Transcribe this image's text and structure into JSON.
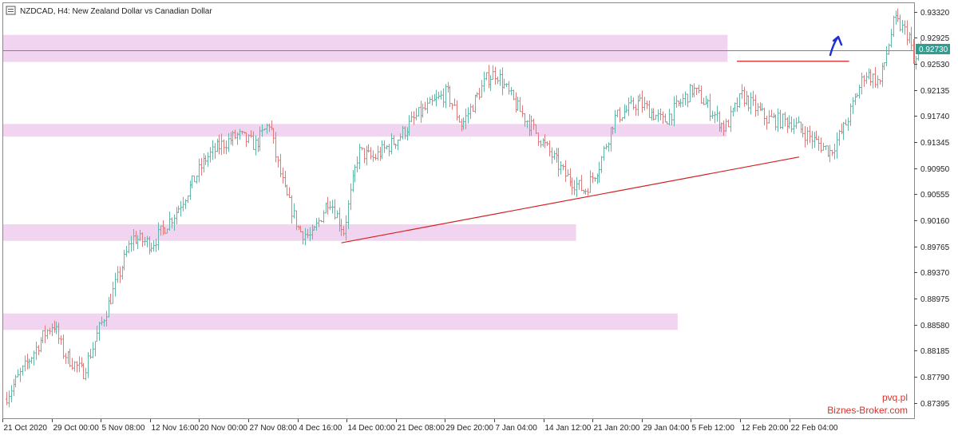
{
  "chart_data": {
    "type": "candlestick",
    "title": "NZDCAD, H4:  New Zealand Dollar vs Canadian Dollar",
    "watermark": [
      "pvq.pl",
      "Biznes-Broker.com"
    ],
    "current_price": "0.92730",
    "ylim": [
      0.8715,
      0.9345
    ],
    "y_ticks": [
      "0.93320",
      "0.92925",
      "0.92530",
      "0.92135",
      "0.91740",
      "0.91345",
      "0.90950",
      "0.90555",
      "0.90160",
      "0.89765",
      "0.89370",
      "0.88975",
      "0.88580",
      "0.88185",
      "0.87790",
      "0.87395"
    ],
    "x_ticks": [
      "21 Oct 2020",
      "29 Oct 00:00",
      "5 Nov 08:00",
      "12 Nov 16:00",
      "20 Nov 00:00",
      "27 Nov 08:00",
      "4 Dec 16:00",
      "14 Dec 00:00",
      "21 Dec 08:00",
      "29 Dec 20:00",
      "7 Jan 04:00",
      "14 Jan 12:00",
      "21 Jan 20:00",
      "29 Jan 04:00",
      "5 Feb 12:00",
      "12 Feb 20:00",
      "22 Feb 04:00"
    ],
    "colors": {
      "bull": "#5fb8a8",
      "bear": "#e07b7b",
      "zone": "#f0d4f0",
      "trend": "#d42020",
      "price_line": "#3aa39a",
      "price_label": "#2e9e92",
      "arrow": "#1f2fd8"
    },
    "zones": [
      {
        "from": 0.9256,
        "to": 0.9297,
        "end": "5 Feb 12:00"
      },
      {
        "from": 0.9143,
        "to": 0.9162,
        "end": "5 Feb 12:00"
      },
      {
        "from": 0.8985,
        "to": 0.901,
        "end": "14 Jan 12:00"
      },
      {
        "from": 0.885,
        "to": 0.8875,
        "end": "29 Jan 04:00"
      }
    ],
    "trendlines": [
      {
        "from": [
          "4 Dec 16:00",
          0.8982
        ],
        "to": [
          "12 Feb 20:00",
          0.9112
        ]
      },
      {
        "from": [
          "12 Feb 20:00",
          0.9257
        ],
        "to": [
          "22 Feb 04:00",
          0.9257
        ]
      }
    ],
    "path": [
      [
        0.0,
        0.8745
      ],
      [
        0.8,
        0.8792
      ],
      [
        1.6,
        0.8842
      ],
      [
        2.0,
        0.886
      ],
      [
        2.4,
        0.8815
      ],
      [
        3.2,
        0.8785
      ],
      [
        4.0,
        0.8865
      ],
      [
        5.2,
        0.899
      ],
      [
        6.0,
        0.898
      ],
      [
        7.0,
        0.903
      ],
      [
        8.2,
        0.911
      ],
      [
        8.8,
        0.913
      ],
      [
        9.5,
        0.9145
      ],
      [
        10.2,
        0.913
      ],
      [
        10.8,
        0.9165
      ],
      [
        11.0,
        0.912
      ],
      [
        11.4,
        0.906
      ],
      [
        12.0,
        0.9
      ],
      [
        12.5,
        0.899
      ],
      [
        13.2,
        0.905
      ],
      [
        13.8,
        0.9
      ],
      [
        14.4,
        0.912
      ],
      [
        15.0,
        0.911
      ],
      [
        16.0,
        0.914
      ],
      [
        16.8,
        0.9175
      ],
      [
        18.0,
        0.921
      ],
      [
        18.6,
        0.916
      ],
      [
        19.6,
        0.923
      ],
      [
        20.0,
        0.924
      ],
      [
        20.8,
        0.919
      ],
      [
        21.6,
        0.915
      ],
      [
        22.8,
        0.9085
      ],
      [
        23.6,
        0.906
      ],
      [
        24.2,
        0.91
      ],
      [
        24.8,
        0.917
      ],
      [
        25.8,
        0.9195
      ],
      [
        26.8,
        0.9165
      ],
      [
        28.0,
        0.9215
      ],
      [
        28.8,
        0.918
      ],
      [
        29.3,
        0.9155
      ],
      [
        30.0,
        0.9205
      ],
      [
        31.0,
        0.917
      ],
      [
        32.0,
        0.9165
      ],
      [
        33.0,
        0.9135
      ],
      [
        33.6,
        0.912
      ],
      [
        34.2,
        0.916
      ],
      [
        35.0,
        0.924
      ],
      [
        35.6,
        0.9225
      ],
      [
        36.2,
        0.932
      ],
      [
        36.8,
        0.9295
      ],
      [
        37.0,
        0.925
      ],
      [
        37.2,
        0.9273
      ]
    ],
    "axis_note": "x positions of path are in candle-time units where each x tick label is 2 units apart"
  }
}
